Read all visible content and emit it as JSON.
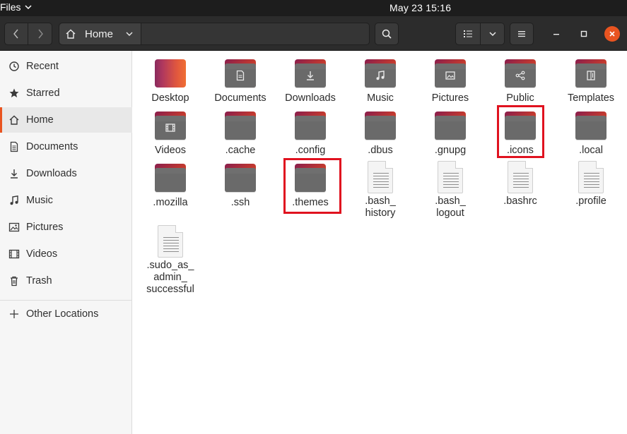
{
  "topbar": {
    "app_name": "Files",
    "clock": "May 23  15:16"
  },
  "header": {
    "path_segment": "Home"
  },
  "sidebar": {
    "items": [
      {
        "label": "Recent",
        "icon": "clock-icon"
      },
      {
        "label": "Starred",
        "icon": "star-icon"
      },
      {
        "label": "Home",
        "icon": "home-icon",
        "active": true
      },
      {
        "label": "Documents",
        "icon": "document-icon"
      },
      {
        "label": "Downloads",
        "icon": "download-icon"
      },
      {
        "label": "Music",
        "icon": "music-icon"
      },
      {
        "label": "Pictures",
        "icon": "picture-icon"
      },
      {
        "label": "Videos",
        "icon": "video-icon"
      },
      {
        "label": "Trash",
        "icon": "trash-icon"
      }
    ],
    "other_locations": "Other Locations"
  },
  "files": [
    {
      "name": "Desktop",
      "type": "desktop"
    },
    {
      "name": "Documents",
      "type": "folder",
      "emblem": "document"
    },
    {
      "name": "Downloads",
      "type": "folder",
      "emblem": "download"
    },
    {
      "name": "Music",
      "type": "folder",
      "emblem": "music"
    },
    {
      "name": "Pictures",
      "type": "folder",
      "emblem": "picture"
    },
    {
      "name": "Public",
      "type": "folder",
      "emblem": "share"
    },
    {
      "name": "Templates",
      "type": "folder",
      "emblem": "template"
    },
    {
      "name": "Videos",
      "type": "folder",
      "emblem": "video"
    },
    {
      "name": ".cache",
      "type": "folder"
    },
    {
      "name": ".config",
      "type": "folder"
    },
    {
      "name": ".dbus",
      "type": "folder"
    },
    {
      "name": ".gnupg",
      "type": "folder"
    },
    {
      "name": ".icons",
      "type": "folder",
      "highlighted": true
    },
    {
      "name": ".local",
      "type": "folder"
    },
    {
      "name": ".mozilla",
      "type": "folder"
    },
    {
      "name": ".ssh",
      "type": "folder"
    },
    {
      "name": ".themes",
      "type": "folder",
      "highlighted": true
    },
    {
      "name": ".bash_\nhistory",
      "type": "text"
    },
    {
      "name": ".bash_\nlogout",
      "type": "text"
    },
    {
      "name": ".bashrc",
      "type": "text"
    },
    {
      "name": ".profile",
      "type": "text"
    },
    {
      "name": ".sudo_as_\nadmin_\nsuccessful",
      "type": "text"
    }
  ],
  "colors": {
    "accent": "#e95420",
    "highlight": "#e0121f",
    "folder_body": "#6a6a6a"
  }
}
